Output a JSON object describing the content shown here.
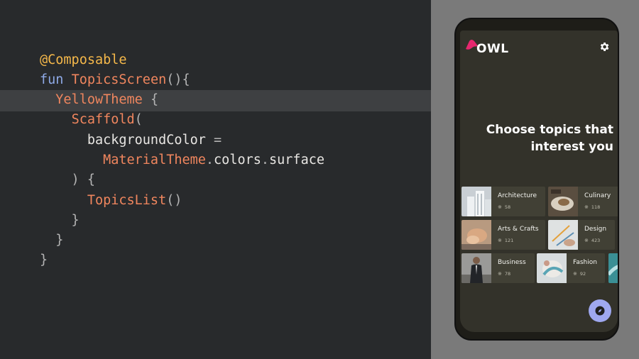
{
  "code": {
    "lines": [
      {
        "tokens": [
          {
            "text": "@Composable",
            "cls": "c-ann"
          }
        ]
      },
      {
        "tokens": [
          {
            "text": "fun ",
            "cls": "c-kw"
          },
          {
            "text": "TopicsScreen",
            "cls": "c-fn"
          },
          {
            "text": "(){",
            "cls": "c-br"
          }
        ]
      },
      {
        "tokens": [
          {
            "text": "  ",
            "cls": "c-pl"
          },
          {
            "text": "YellowTheme",
            "cls": "c-fn"
          },
          {
            "text": " {",
            "cls": "c-br"
          }
        ]
      },
      {
        "tokens": [
          {
            "text": "    ",
            "cls": "c-pl"
          },
          {
            "text": "Scaffold",
            "cls": "c-fn"
          },
          {
            "text": "(",
            "cls": "c-br"
          }
        ]
      },
      {
        "tokens": [
          {
            "text": "      backgroundColor ",
            "cls": "c-pl"
          },
          {
            "text": "=",
            "cls": "c-br"
          }
        ]
      },
      {
        "tokens": [
          {
            "text": "        ",
            "cls": "c-pl"
          },
          {
            "text": "MaterialTheme",
            "cls": "c-fn"
          },
          {
            "text": ".",
            "cls": "c-br"
          },
          {
            "text": "colors",
            "cls": "c-pl"
          },
          {
            "text": ".",
            "cls": "c-br"
          },
          {
            "text": "surface",
            "cls": "c-pl"
          }
        ]
      },
      {
        "tokens": [
          {
            "text": "    ) {",
            "cls": "c-br"
          }
        ]
      },
      {
        "tokens": [
          {
            "text": "      ",
            "cls": "c-pl"
          },
          {
            "text": "TopicsList",
            "cls": "c-fn"
          },
          {
            "text": "()",
            "cls": "c-br"
          }
        ]
      },
      {
        "tokens": [
          {
            "text": "    }",
            "cls": "c-br"
          }
        ]
      },
      {
        "tokens": [
          {
            "text": "  }",
            "cls": "c-br"
          }
        ]
      },
      {
        "tokens": [
          {
            "text": "}",
            "cls": "c-br"
          }
        ]
      }
    ],
    "highlighted_line": 2
  },
  "app": {
    "logo_text": "OWL",
    "settings_icon": "gear-icon",
    "headline_line1": "Choose topics that",
    "headline_line2": "interest you",
    "fab_icon": "compass-icon",
    "accent_color": "#9fa8f0",
    "logo_color": "#e6276e",
    "surface_color": "#33322a"
  },
  "topics": [
    {
      "label": "Architecture",
      "count": "58",
      "row": 0
    },
    {
      "label": "Culinary",
      "count": "118",
      "row": 0
    },
    {
      "label": "Arts & Crafts",
      "count": "121",
      "row": 1
    },
    {
      "label": "Design",
      "count": "423",
      "row": 1
    },
    {
      "label": "Business",
      "count": "78",
      "row": 2
    },
    {
      "label": "Fashion",
      "count": "92",
      "row": 2
    }
  ]
}
